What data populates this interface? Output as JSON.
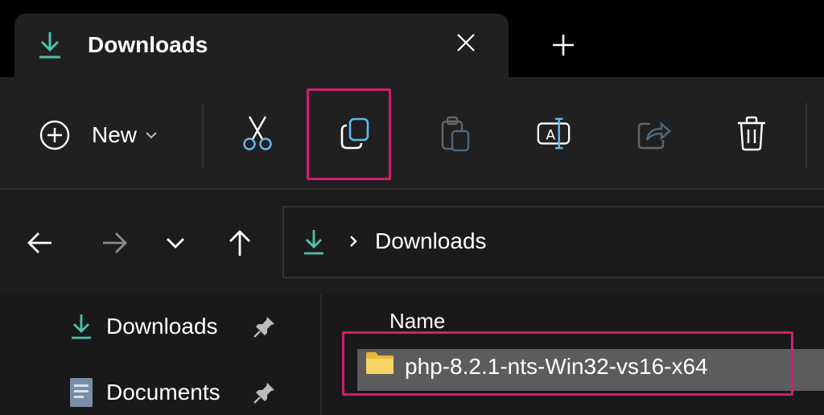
{
  "window": {
    "tab_title": "Downloads",
    "tab_icon": "download-icon",
    "close_icon": "close-icon",
    "new_tab_icon": "plus-icon"
  },
  "toolbar": {
    "new_label": "New",
    "tools": [
      {
        "name": "cut",
        "icon": "scissors-icon",
        "enabled": true
      },
      {
        "name": "copy",
        "icon": "copy-icon",
        "enabled": true,
        "highlighted": true
      },
      {
        "name": "paste",
        "icon": "paste-icon",
        "enabled": false
      },
      {
        "name": "rename",
        "icon": "rename-icon",
        "enabled": true
      },
      {
        "name": "share",
        "icon": "share-icon",
        "enabled": false
      },
      {
        "name": "delete",
        "icon": "trash-icon",
        "enabled": true
      }
    ]
  },
  "address": {
    "path": "Downloads",
    "icon": "download-icon"
  },
  "sidebar": {
    "items": [
      {
        "label": "Downloads",
        "icon": "download-icon",
        "pinned": true
      },
      {
        "label": "Documents",
        "icon": "document-icon",
        "pinned": true
      }
    ]
  },
  "file_list": {
    "column_header": "Name",
    "rows": [
      {
        "name": "php-8.2.1-nts-Win32-vs16-x64",
        "type": "folder",
        "selected": true,
        "highlighted": true
      }
    ]
  },
  "colors": {
    "accent_teal": "#4cc2b0",
    "highlight_pink": "#d1206e",
    "folder_yellow": "#f2c94c",
    "copy_blue": "#60b8f0"
  }
}
